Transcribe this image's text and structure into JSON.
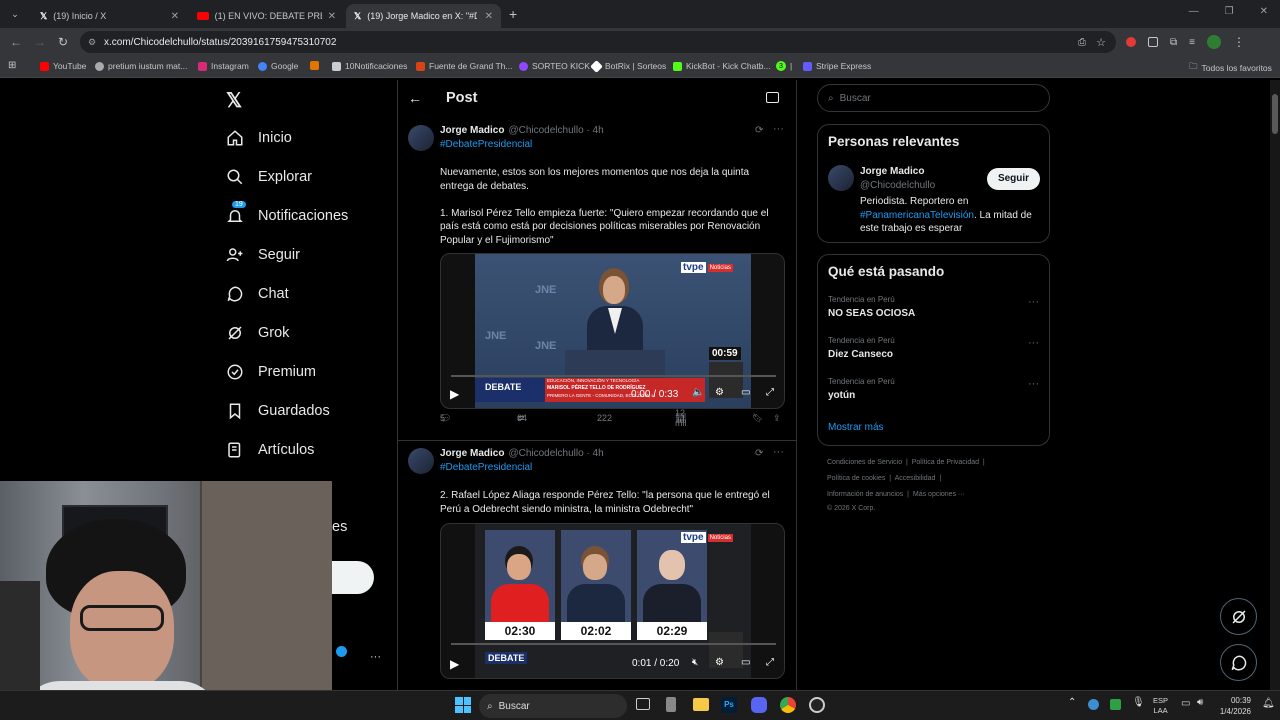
{
  "browser": {
    "tabs": [
      {
        "label": "(19) Inicio / X"
      },
      {
        "label": "(1) EN VIVO: DEBATE PRESIDEN"
      },
      {
        "label": "(19) Jorge Madico en X: \"#Deba"
      }
    ],
    "url": "x.com/Chicodelchullo/status/2039161759475310702",
    "bookmarks": [
      {
        "label": "YouTube",
        "color": "#ff0000"
      },
      {
        "label": "pretium iustum mat...",
        "color": "#aaaaaa"
      },
      {
        "label": "Instagram",
        "color": "#d62976"
      },
      {
        "label": "Google",
        "color": "#4285f4"
      },
      {
        "label": "",
        "color": "#e37400"
      },
      {
        "label": "10Notificaciones",
        "color": "#cccccc"
      },
      {
        "label": "Fuente de Grand Th...",
        "color": "#d84315"
      },
      {
        "label": "SORTEO KICK",
        "color": "#9146ff"
      },
      {
        "label": "BotRix | Sorteos",
        "color": "#ffffff"
      },
      {
        "label": "KickBot - Kick Chatb...",
        "color": "#53fc18"
      },
      {
        "label": "3",
        "color": "#53fc18"
      },
      {
        "label": "Stripe Express",
        "color": "#635bff"
      }
    ],
    "all_bookmarks": "Todos los favoritos"
  },
  "nav": {
    "items": [
      {
        "label": "Inicio",
        "icon": "home-icon"
      },
      {
        "label": "Explorar",
        "icon": "search-icon"
      },
      {
        "label": "Notificaciones",
        "icon": "bell-icon",
        "badge": "19"
      },
      {
        "label": "Seguir",
        "icon": "follow-icon"
      },
      {
        "label": "Chat",
        "icon": "chat-icon"
      },
      {
        "label": "Grok",
        "icon": "grok-icon"
      },
      {
        "label": "Premium",
        "icon": "premium-icon"
      },
      {
        "label": "Guardados",
        "icon": "bookmark-icon"
      },
      {
        "label": "Artículos",
        "icon": "articles-icon"
      }
    ],
    "more_label_partial": "es"
  },
  "post": {
    "header_title": "Post",
    "tweets": [
      {
        "author": "Jorge Madico",
        "handle": "@Chicodelchullo · 4h",
        "hashtag": "#DebatePresidencial",
        "text": "Nuevamente, estos son los mejores momentos que nos deja la quinta entrega de debates.\n\n1. Marisol Pérez Tello empieza fuerte: \"Quiero empezar recordando que el país está como está por decisiones políticas miserables por Renovación Popular y el Fujimorismo\"",
        "video_time": "0:00 / 0:33",
        "replies": "5",
        "reposts": "64",
        "likes": "222",
        "views": "12 mil",
        "overlay_timer": "00:59"
      },
      {
        "author": "Jorge Madico",
        "handle": "@Chicodelchullo · 4h",
        "hashtag": "#DebatePresidencial",
        "text": "2. Rafael López Aliaga responde Pérez Tello: \"la persona que le entregó el Perú a Odebrecht siendo ministra, la ministra Odebrecht\"",
        "video_time": "0:01 / 0:20",
        "timers": [
          "02:30",
          "02:02",
          "02:29"
        ]
      }
    ]
  },
  "sidebar": {
    "search_placeholder": "Buscar",
    "relevant": {
      "title": "Personas relevantes",
      "name": "Jorge Madico",
      "handle": "@Chicodelchullo",
      "follow": "Seguir",
      "bio_1": "Periodista. Reportero en",
      "bio_link": "#PanamericanaTelevisión",
      "bio_2": ". La mitad de",
      "bio_3": "este trabajo es esperar"
    },
    "trending": {
      "title": "Qué está pasando",
      "items": [
        {
          "context": "Tendencia en Perú",
          "name": "NO SEAS OCIOSA"
        },
        {
          "context": "Tendencia en Perú",
          "name": "Diez Canseco"
        },
        {
          "context": "Tendencia en Perú",
          "name": "yotún"
        }
      ],
      "more": "Mostrar más"
    },
    "footer": [
      "Condiciones de Servicio",
      "Política de Privacidad",
      "Política de cookies",
      "Accesibilidad",
      "Información de anuncios",
      "Más opciones ···",
      "© 2026 X Corp."
    ]
  },
  "taskbar": {
    "search": "Buscar",
    "lang": "ESP",
    "lang2": "LAA",
    "time": "00:39",
    "date": "1/4/2026"
  },
  "video_labels": {
    "tvpe": "tvpe",
    "noticias": "Noticias",
    "jne": "JNE",
    "debate": "DEBATE",
    "lower_third_1": "EDUCACIÓN, INNOVACIÓN Y TECNOLOGÍA",
    "lower_third_2": "MARISOL PÉREZ TELLO DE RODRÍGUEZ",
    "lower_third_3": "PRIMERO LA GENTE - COMUNIDAD, ECOLOGÍA, LI"
  }
}
